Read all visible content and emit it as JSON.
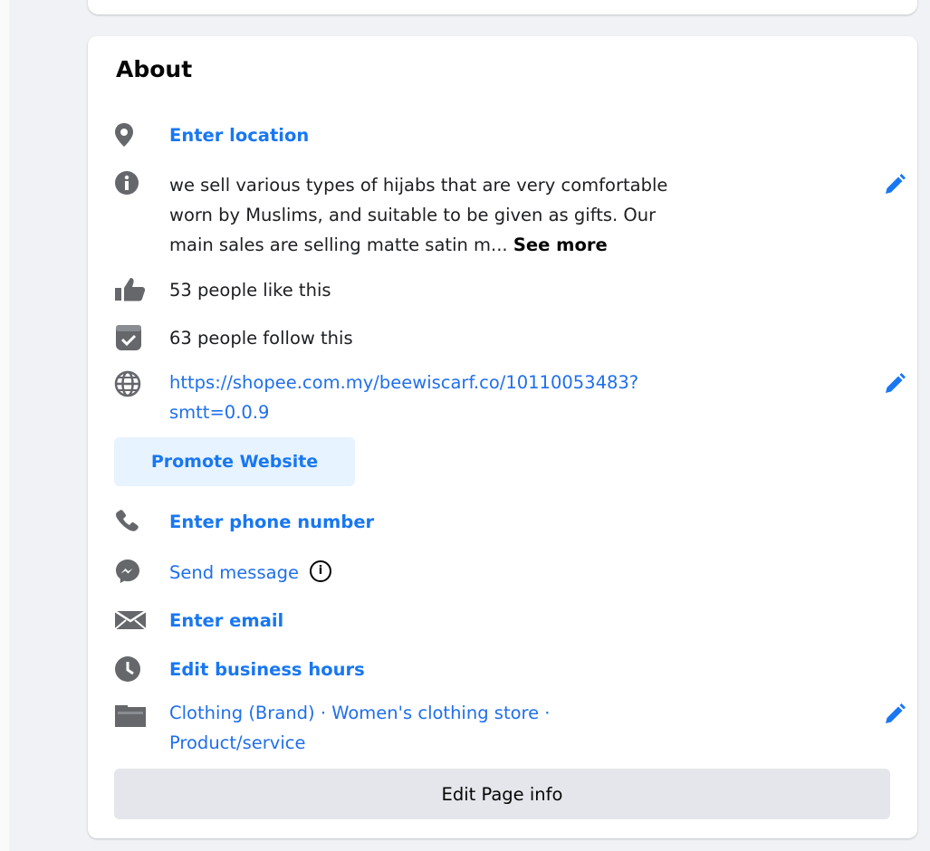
{
  "about": {
    "title": "About",
    "location_label": "Enter location",
    "description_lines": [
      "we sell various types of hijabs that are very comfortable",
      "worn by Muslims, and suitable to be given as gifts. Our",
      "main sales are selling matte satin m..."
    ],
    "see_more_label": "See more",
    "likes_text": "53 people like this",
    "follows_text": "63 people follow this",
    "website_lines": [
      "https://shopee.com.my/beewiscarf.co/10110053483?",
      "smtt=0.0.9"
    ],
    "promote_button_label": "Promote Website",
    "phone_label": "Enter phone number",
    "message_label": "Send message",
    "info_glyph": "i",
    "email_label": "Enter email",
    "hours_label": "Edit business hours",
    "category_lines": [
      "Clothing (Brand) · Women's clothing store ·",
      "Product/service"
    ],
    "edit_info_button_label": "Edit Page info"
  },
  "colors": {
    "link": "#1877f2",
    "icon_gray": "#65676b",
    "card_bg": "#ffffff",
    "page_bg": "#f0f2f5",
    "promote_bg": "#e7f3ff",
    "button_gray": "#e4e6eb"
  },
  "icons": [
    "location-pin-icon",
    "info-icon",
    "thumbs-up-icon",
    "follow-check-icon",
    "globe-icon",
    "pencil-icon",
    "phone-icon",
    "messenger-icon",
    "envelope-icon",
    "clock-icon",
    "category-folder-icon"
  ]
}
